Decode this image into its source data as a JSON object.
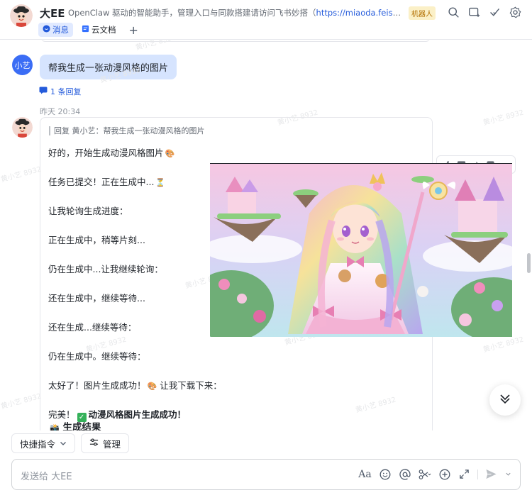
{
  "header": {
    "title": "大EE",
    "description": "OpenClaw 驱动的智能助手，管理入口与同款搭建请访问飞书妙搭（",
    "description_link": "https://miaoda.feishu.cn/...",
    "badge": "机器人",
    "tabs": [
      {
        "label": "消息",
        "icon": "chat-bubble-icon"
      },
      {
        "label": "云文档",
        "icon": "doc-icon"
      }
    ],
    "add_tab": "+"
  },
  "user_message": {
    "avatar_text": "小艺",
    "text": "帮我生成一张动漫风格的图片",
    "reply_count": "1 条回复"
  },
  "bot_message": {
    "time": "昨天 20:34",
    "quote": "回复 黄小艺：帮我生成一张动漫风格的图片",
    "lines": [
      {
        "text": "好的，开始生成动漫风格图片",
        "emoji": "🎨"
      },
      {
        "text": "任务已提交！正在生成中...",
        "emoji": "⏳"
      },
      {
        "text": "让我轮询生成进度："
      },
      {
        "text": "正在生成中，稍等片刻..."
      },
      {
        "text": "仍在生成中...让我继续轮询："
      },
      {
        "text": "还在生成中，继续等待..."
      },
      {
        "text": "还在生成...继续等待："
      },
      {
        "text": "仍在生成中。继续等待："
      },
      {
        "text": "太好了！图片生成成功！",
        "emoji": "🎨",
        "suffix": "让我下载下来："
      },
      {
        "text": "完美！",
        "check": "✓",
        "bold_suffix": "动漫风格图片生成成功！"
      },
      {
        "text": "生成结果",
        "emoji": "📸"
      }
    ],
    "image_icon": "anime-girl-fantasy-image"
  },
  "message_actions": [
    "thumbs-up-icon",
    "comment-icon",
    "forward-icon",
    "reply-icon",
    "more-icon"
  ],
  "quick_actions": {
    "shortcut_label": "快捷指令",
    "manage_label": "管理"
  },
  "composer": {
    "placeholder": "发送给 大EE",
    "tools": [
      "format-icon",
      "emoji-icon",
      "mention-icon",
      "scissors-icon",
      "plus-circle-icon",
      "expand-icon",
      "send-icon",
      "chevron-down-icon"
    ]
  },
  "watermark_text": "黄小艺 8932",
  "colors": {
    "accent": "#245bdb",
    "user_bubble": "#d6e4fe",
    "badge_bg": "#fbf0c7"
  }
}
